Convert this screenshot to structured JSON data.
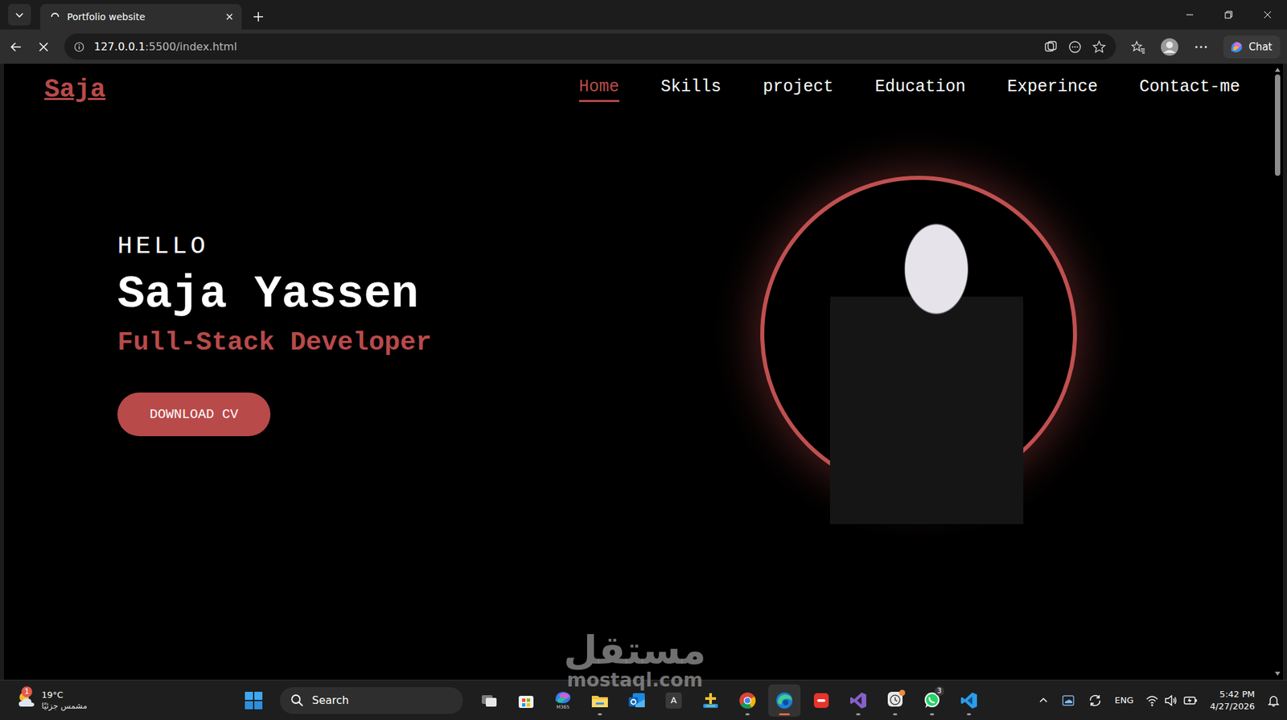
{
  "browser": {
    "tab": {
      "title": "Portfolio website",
      "loading": true,
      "selected": true
    },
    "address": {
      "host": "127.0.0.1",
      "path": ":5500/index.html"
    },
    "chat": "Chat"
  },
  "page": {
    "logo": "Saja",
    "nav": [
      {
        "label": "Home",
        "selected": true
      },
      {
        "label": "Skills",
        "selected": false
      },
      {
        "label": "project",
        "selected": false
      },
      {
        "label": "Education",
        "selected": false
      },
      {
        "label": "Experince",
        "selected": false
      },
      {
        "label": "Contact-me",
        "selected": false
      }
    ],
    "greeting": "HELLO",
    "name": "Saja Yassen",
    "role": "Full-Stack Developer",
    "cta": "DOWNLOAD CV"
  },
  "scrollbar": {
    "level": 0.17
  },
  "watermark": {
    "arabic": "مستقل",
    "latin": "mostaql.com"
  },
  "taskbar": {
    "weather": {
      "temp": "19°C",
      "condition": "مشمس جزئيًا",
      "badge": "1"
    },
    "search": {
      "placeholder": "Search"
    },
    "apps": [
      {
        "kind": "taskview",
        "running": false,
        "active": false
      },
      {
        "kind": "store",
        "running": false,
        "active": false
      },
      {
        "kind": "m365",
        "label": "M365",
        "running": false,
        "active": false
      },
      {
        "kind": "files",
        "running": true,
        "active": false
      },
      {
        "kind": "outlook",
        "running": false,
        "active": false
      },
      {
        "kind": "font",
        "label": "A",
        "running": false,
        "active": false
      },
      {
        "kind": "tool",
        "running": false,
        "active": false
      },
      {
        "kind": "chrome",
        "running": true,
        "active": false
      },
      {
        "kind": "edge",
        "running": true,
        "active": true
      },
      {
        "kind": "wps",
        "running": false,
        "active": false
      },
      {
        "kind": "studio",
        "running": true,
        "active": false
      },
      {
        "kind": "clock",
        "running": true,
        "active": false,
        "alert": true
      },
      {
        "kind": "whatsapp",
        "running": true,
        "active": false,
        "badge": "3"
      },
      {
        "kind": "vscode",
        "running": true,
        "active": false
      }
    ],
    "tray": {
      "language": "ENG",
      "time": "5:42 PM",
      "date": "4/27/2026"
    }
  }
}
